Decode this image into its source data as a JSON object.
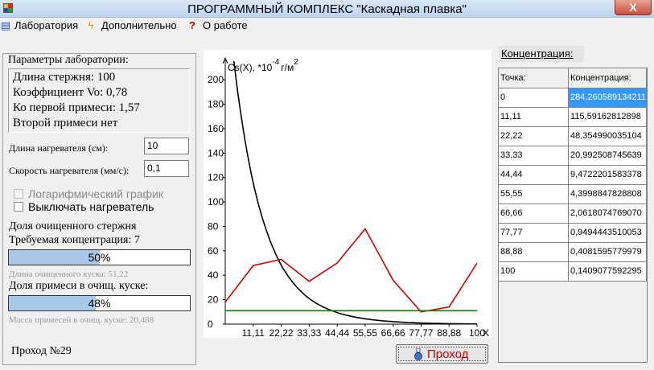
{
  "window": {
    "title": "ПРОГРАММНЫЙ КОМПЛЕКС \"Каскадная плавка\"",
    "close_glyph": "X"
  },
  "menu": [
    {
      "label": "Лаборатория",
      "icon": "books-icon"
    },
    {
      "label": "Дополнительно",
      "icon": "lightning-icon"
    },
    {
      "label": "О работе",
      "icon": "question-icon"
    }
  ],
  "left": {
    "title": "Параметры лаборатории:",
    "params": [
      "Длина стержня: 100",
      "Коэффициент Vo: 0,78",
      "Ко первой примеси: 1,57",
      "Второй примеси нет"
    ],
    "heater_length_label": "Длина нагревателя (см):",
    "heater_length_value": "10",
    "heater_speed_label": "Скорость нагревателя (мм/с):",
    "heater_speed_value": "0,1",
    "log_chart_label": "Логарифмический график",
    "heater_off_label": "Выключать нагреватель",
    "purified_share_label": "Доля очищенного стержня",
    "required_conc_label": "Требуемая концентрация: 7",
    "progress1": {
      "value": 50,
      "text": "50%"
    },
    "purified_length_note": "Длина очищенного куска: 51,22",
    "impurity_share_label": "Доля примеси в очищ. куске:",
    "progress2": {
      "value": 48,
      "text": "48%"
    },
    "impurity_mass_note": "Масса примесей в очищ. куске: 20,488",
    "pass_label": "Проход №29"
  },
  "chart_data": {
    "type": "line",
    "ylabel": "Cs(X), *10⁻⁴ г/м²",
    "ylabel_parts": {
      "main": "Cs(X), *10",
      "exp": "-4",
      "unit": "г/м",
      "unit_exp": "2"
    },
    "xlabel": "X",
    "ylim": [
      0,
      210
    ],
    "xlim": [
      0,
      100
    ],
    "y_ticks": [
      0,
      20,
      40,
      60,
      80,
      100,
      120,
      140,
      160,
      180,
      200
    ],
    "x_ticks": [
      "11,11",
      "22,22",
      "33,33",
      "44,44",
      "55,55",
      "66,66",
      "77,77",
      "88,88",
      "100"
    ],
    "series": [
      {
        "color": "#000000",
        "x": [
          0,
          11.11,
          22.22,
          33.33,
          44.44,
          55.55,
          66.66,
          77.77,
          88.88,
          100
        ],
        "values": [
          284.26,
          115.59,
          48.35,
          20.99,
          9.47,
          4.4,
          2.06,
          0.95,
          0.41,
          0.14
        ]
      },
      {
        "color": "#d00000",
        "x": [
          0,
          11.11,
          22.22,
          33.33,
          44.44,
          55.55,
          66.66,
          77.77,
          88.88,
          100
        ],
        "values": [
          18,
          48,
          53,
          35,
          50,
          78,
          36,
          10,
          14,
          50
        ]
      },
      {
        "color": "#008000",
        "x": [
          0,
          100
        ],
        "values": [
          11,
          11
        ]
      }
    ]
  },
  "button": {
    "label": "Проход",
    "icon": "flask-icon"
  },
  "concentration": {
    "title": "Концентрация:",
    "columns": [
      "Точка:",
      "Концентрация:"
    ],
    "rows": [
      [
        "0",
        "284,260589134211"
      ],
      [
        "11,11",
        "115,59162812898"
      ],
      [
        "22,22",
        "48,354990035104"
      ],
      [
        "33,33",
        "20,992508745639"
      ],
      [
        "44,44",
        "9,4722201583378"
      ],
      [
        "55,55",
        "4,3998847828808"
      ],
      [
        "66,66",
        "2,0618074769070"
      ],
      [
        "77,77",
        "0,9494443510053"
      ],
      [
        "88,88",
        "0,4081595779979"
      ],
      [
        "100",
        "0,1409077592295"
      ]
    ],
    "selected_row": 0
  }
}
